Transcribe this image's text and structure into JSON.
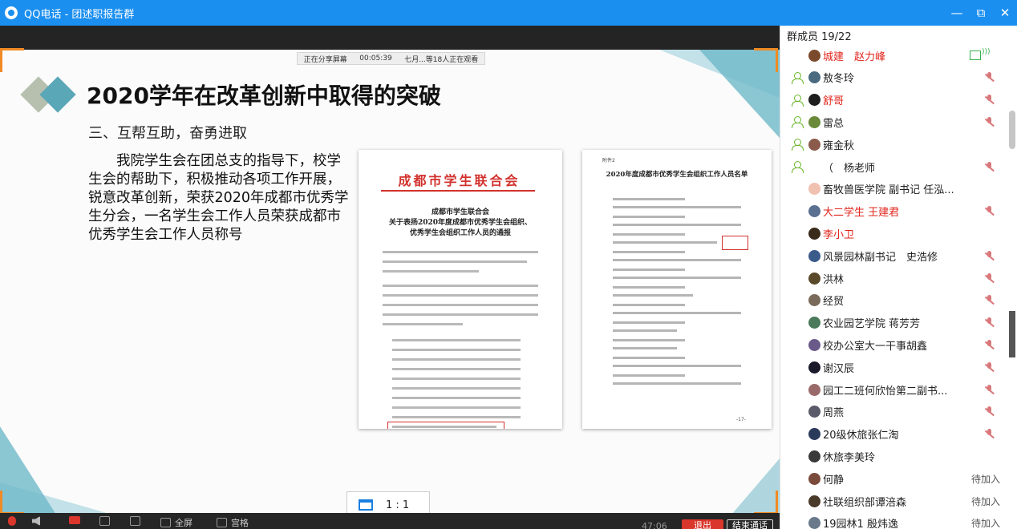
{
  "window": {
    "title": "QQ电话 - 团述职报告群",
    "minimize": "—",
    "restore": "⧉",
    "close": "✕"
  },
  "share": {
    "status": "正在分享屏幕",
    "duration": "00:05:39",
    "viewers": "七月...等18人正在观看"
  },
  "slide": {
    "title": "2020学年在改革创新中取得的突破",
    "subtitle": "三、互帮互助，奋勇进取",
    "body": "我院学生会在团总支的指导下，校学生会的帮助下，积极推动各项工作开展，锐意改革创新，荣获2020年成都市优秀学生分会，一名学生会工作人员荣获成都市优秀学生会工作人员称号"
  },
  "doc1": {
    "org": "成都市学生联合会",
    "heading1": "成都市学生联合会",
    "heading2": "关于表扬2020年度成都市优秀学生会组织、",
    "heading3": "优秀学生会组织工作人员的通报"
  },
  "doc2": {
    "tag": "附件2",
    "heading": "2020年度成都市优秀学生会组织工作人员名单",
    "page": "-17-"
  },
  "view": {
    "ratio": "1 : 1"
  },
  "toolbar": {
    "fullscreen": "全屏",
    "grid": "宫格",
    "time": "47:06",
    "exit": "退出",
    "end": "结束通话"
  },
  "panel": {
    "count": "群成员 19/22",
    "members": [
      {
        "name": "城建　赵力峰",
        "red": true,
        "host": false,
        "status": "screen",
        "avatar": "#7b4a2c"
      },
      {
        "name": "敖冬玲",
        "red": false,
        "host": true,
        "status": "muted",
        "avatar": "#4a6a80"
      },
      {
        "name": "舒哥",
        "red": true,
        "host": true,
        "status": "muted",
        "avatar": "#1d1d1d"
      },
      {
        "name": "雷总",
        "red": false,
        "host": true,
        "status": "muted",
        "avatar": "#6a8a3a"
      },
      {
        "name": "雍金秋",
        "red": false,
        "host": true,
        "status": "none",
        "avatar": "#8a5a4a"
      },
      {
        "name": "（　杨老师",
        "red": false,
        "host": true,
        "status": "muted",
        "avatar": ""
      },
      {
        "name": "畜牧兽医学院 副书记 任泓...",
        "red": false,
        "host": false,
        "status": "none",
        "avatar": "#f0c0b0"
      },
      {
        "name": "大二学生 王建君",
        "red": true,
        "host": false,
        "status": "muted",
        "avatar": "#5a7090"
      },
      {
        "name": "李小卫",
        "red": true,
        "host": false,
        "status": "none",
        "avatar": "#3a2a1a"
      },
      {
        "name": "风景园林副书记　史浩修",
        "red": false,
        "host": false,
        "status": "muted",
        "avatar": "#3a5a8a"
      },
      {
        "name": "洪林",
        "red": false,
        "host": false,
        "status": "muted",
        "avatar": "#5a4a2a"
      },
      {
        "name": "经贸",
        "red": false,
        "host": false,
        "status": "muted",
        "avatar": "#7a6a5a"
      },
      {
        "name": "农业园艺学院 蒋芳芳",
        "red": false,
        "host": false,
        "status": "muted",
        "avatar": "#4a7a5a"
      },
      {
        "name": "校办公室大一干事胡鑫",
        "red": false,
        "host": false,
        "status": "muted",
        "avatar": "#6a5a8a"
      },
      {
        "name": "谢汉辰",
        "red": false,
        "host": false,
        "status": "muted",
        "avatar": "#1a1a2a"
      },
      {
        "name": "园工二班何欣怡第二副书...",
        "red": false,
        "host": false,
        "status": "muted",
        "avatar": "#9a6a6a"
      },
      {
        "name": "周燕",
        "red": false,
        "host": false,
        "status": "muted",
        "avatar": "#5a5a6a"
      },
      {
        "name": "20级休旅张仁淘",
        "red": false,
        "host": false,
        "status": "muted",
        "avatar": "#2a3a5a"
      },
      {
        "name": "休旅李美玲",
        "red": false,
        "host": false,
        "status": "none",
        "avatar": "#3a3a3a"
      },
      {
        "name": "何静",
        "red": false,
        "host": false,
        "status": "waiting",
        "avatar": "#7a4a3a"
      },
      {
        "name": "社联组织部谭涪森",
        "red": false,
        "host": false,
        "status": "waiting",
        "avatar": "#4a3a2a"
      },
      {
        "name": "19园林1 殷炜逸",
        "red": false,
        "host": false,
        "status": "waiting",
        "avatar": "#6a7a8a"
      }
    ],
    "waiting_label": "待加入"
  }
}
